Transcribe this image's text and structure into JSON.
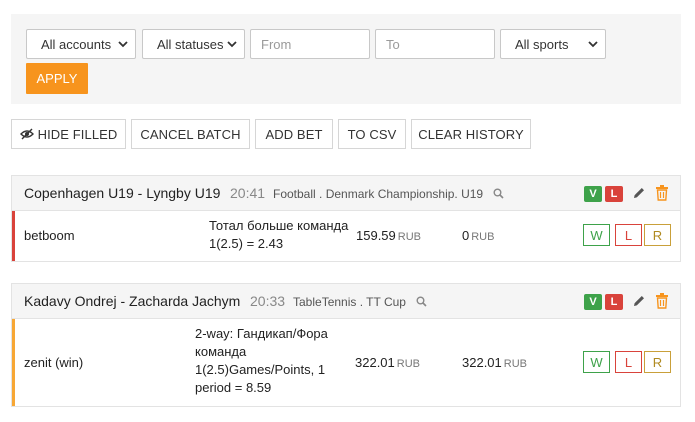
{
  "filters": {
    "accounts": "All accounts",
    "statuses": "All statuses",
    "from_placeholder": "From",
    "to_placeholder": "To",
    "sports": "All sports",
    "apply": "APPLY"
  },
  "toolbar": {
    "hide_filled": "HIDE FILLED",
    "cancel_batch": "CANCEL BATCH",
    "add_bet": "ADD BET",
    "to_csv": "TO CSV",
    "clear_history": "CLEAR HISTORY"
  },
  "colors": {
    "accent": "#f7941d",
    "won": "#3ea24a",
    "lost": "#d9433b",
    "refund": "#c9a03a"
  },
  "bets": [
    {
      "match": "Copenhagen U19 - Lyngby U19",
      "time": "20:41",
      "league": "Football  . Denmark Championship. U19",
      "badge_v": "V",
      "badge_l": "L",
      "bookmaker": "betboom",
      "market": "Тотал больше команда 1(2.5) = 2.43",
      "stake": "159.59",
      "stake_currency": "RUB",
      "payout": "0",
      "payout_currency": "RUB",
      "btn_w": "W",
      "btn_l": "L",
      "btn_r": "R"
    },
    {
      "match": "Kadavy Ondrej - Zacharda Jachym",
      "time": "20:33",
      "league": "TableTennis  . TT Cup",
      "badge_v": "V",
      "badge_l": "L",
      "bookmaker": "zenit (win)",
      "market": "2-way: Гандикап/Фора команда 1(2.5)Games/Points, 1 period = 8.59",
      "stake": "322.01",
      "stake_currency": "RUB",
      "payout": "322.01",
      "payout_currency": "RUB",
      "btn_w": "W",
      "btn_l": "L",
      "btn_r": "R"
    }
  ]
}
